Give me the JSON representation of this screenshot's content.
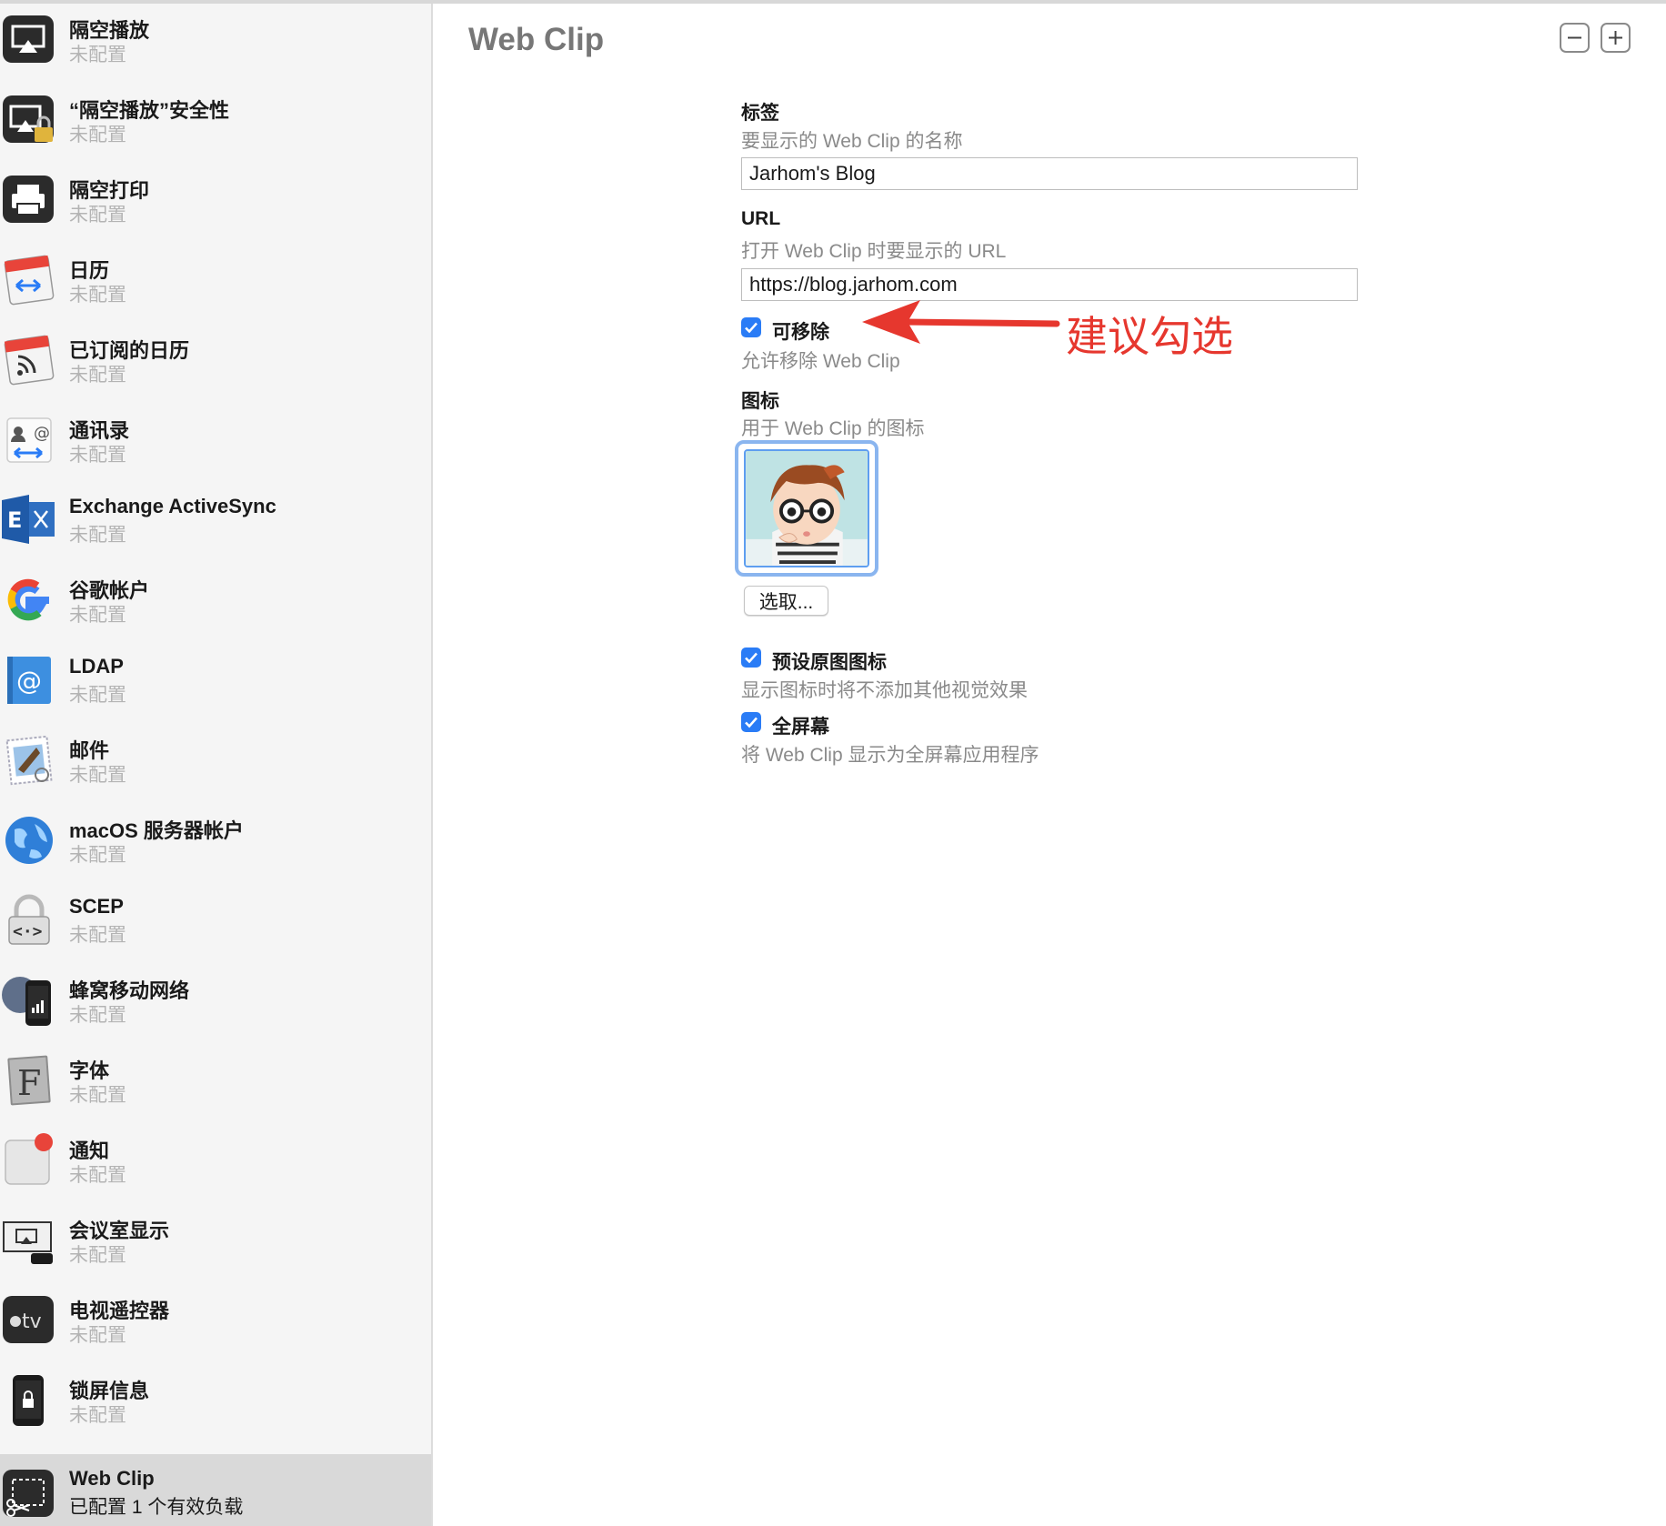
{
  "sidebar": {
    "items": [
      {
        "title": "隔空播放",
        "subtitle": "未配置",
        "icon": "airplay-icon"
      },
      {
        "title": "“隔空播放”安全性",
        "subtitle": "未配置",
        "icon": "airplay-security-icon"
      },
      {
        "title": "隔空打印",
        "subtitle": "未配置",
        "icon": "printer-icon"
      },
      {
        "title": "日历",
        "subtitle": "未配置",
        "icon": "calendar-icon"
      },
      {
        "title": "已订阅的日历",
        "subtitle": "未配置",
        "icon": "subscribed-calendar-icon"
      },
      {
        "title": "通讯录",
        "subtitle": "未配置",
        "icon": "contacts-icon"
      },
      {
        "title": "Exchange ActiveSync",
        "subtitle": "未配置",
        "icon": "exchange-icon"
      },
      {
        "title": "谷歌帐户",
        "subtitle": "未配置",
        "icon": "google-icon"
      },
      {
        "title": "LDAP",
        "subtitle": "未配置",
        "icon": "ldap-icon"
      },
      {
        "title": "邮件",
        "subtitle": "未配置",
        "icon": "mail-icon"
      },
      {
        "title": "macOS 服务器帐户",
        "subtitle": "未配置",
        "icon": "globe-icon"
      },
      {
        "title": "SCEP",
        "subtitle": "未配置",
        "icon": "lock-icon"
      },
      {
        "title": "蜂窝移动网络",
        "subtitle": "未配置",
        "icon": "cellular-icon"
      },
      {
        "title": "字体",
        "subtitle": "未配置",
        "icon": "font-icon"
      },
      {
        "title": "通知",
        "subtitle": "未配置",
        "icon": "notification-icon"
      },
      {
        "title": "会议室显示",
        "subtitle": "未配置",
        "icon": "conference-display-icon"
      },
      {
        "title": "电视遥控器",
        "subtitle": "未配置",
        "icon": "apple-tv-icon"
      },
      {
        "title": "锁屏信息",
        "subtitle": "未配置",
        "icon": "lock-screen-icon"
      },
      {
        "title": "Web Clip",
        "subtitle": "已配置 1 个有效负载",
        "icon": "web-clip-icon",
        "selected": true
      }
    ]
  },
  "panel": {
    "title": "Web Clip",
    "minus_icon": "minus-icon",
    "plus_icon": "plus-icon"
  },
  "form": {
    "label_title": "标签",
    "label_desc": "要显示的 Web Clip 的名称",
    "label_value": "Jarhom's Blog",
    "url_title": "URL",
    "url_desc": "打开 Web Clip 时要显示的 URL",
    "url_value": "https://blog.jarhom.com",
    "removable_label": "可移除",
    "removable_checked": true,
    "removable_desc": "允许移除 Web Clip",
    "icon_title": "图标",
    "icon_desc": "用于 Web Clip 的图标",
    "choose_button": "选取...",
    "precomposed_label": "预设原图图标",
    "precomposed_checked": true,
    "precomposed_desc": "显示图标时将不添加其他视觉效果",
    "fullscreen_label": "全屏幕",
    "fullscreen_checked": true,
    "fullscreen_desc": "将 Web Clip 显示为全屏幕应用程序"
  },
  "annotation": {
    "text": "建议勾选",
    "color": "#e6372e"
  },
  "colors": {
    "accent": "#2a7cf6",
    "selected_row": "#d9d9d9"
  }
}
